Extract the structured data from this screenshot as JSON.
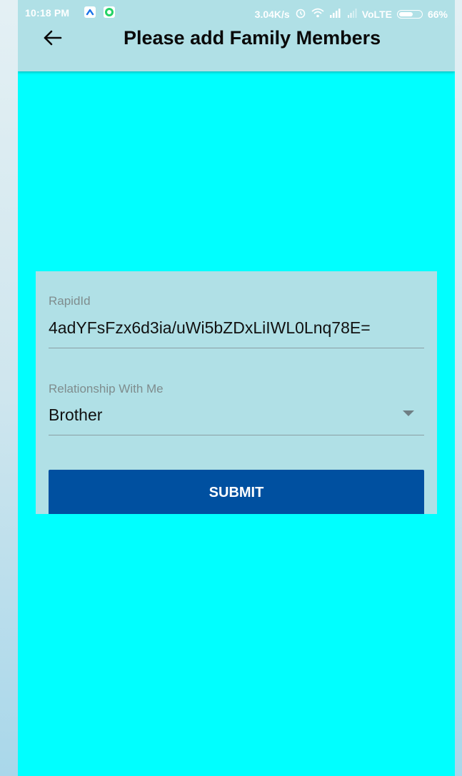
{
  "status_bar": {
    "time": "10:18 PM",
    "network_speed": "3.04K/s",
    "network_type": "VoLTE",
    "battery": "66%",
    "battery_level": 0.66,
    "icons": [
      "notification-app-icon",
      "whatsapp-icon",
      "alarm-icon",
      "wifi-icon",
      "signal-icon",
      "signal-icon-secondary",
      "battery-icon"
    ]
  },
  "app_bar": {
    "title": "Please add Family Members",
    "back_icon": "back-arrow-icon"
  },
  "form": {
    "rapid_id": {
      "label": "RapidId",
      "value": "4adYFsFzx6d3ia/uWi5bZDxLiIWL0Lnq78E="
    },
    "relationship": {
      "label": "Relationship With Me",
      "value": "Brother",
      "icon": "dropdown-arrow-icon"
    },
    "submit_label": "SUBMIT"
  },
  "colors": {
    "background": "#00ffff",
    "app_bar": "#b0e0e6",
    "card": "#b0e0e6",
    "button": "#0050a0",
    "button_text": "#ffffff"
  }
}
